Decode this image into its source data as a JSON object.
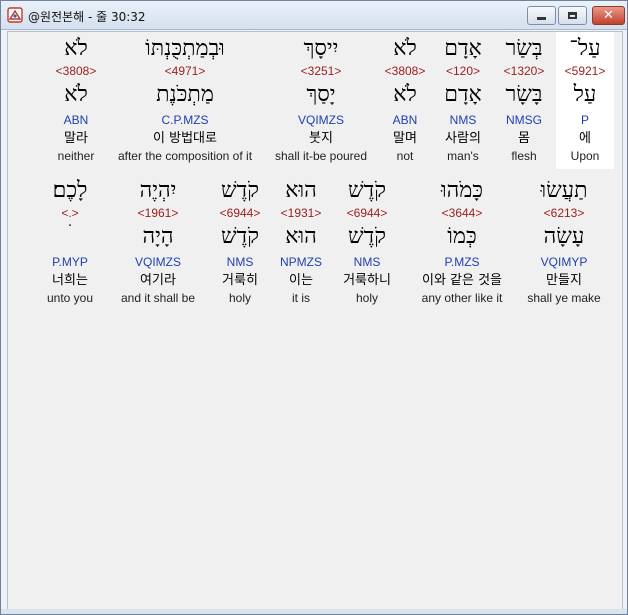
{
  "window": {
    "title": "@원전본해 - 줄 30:32",
    "minimize_label": "",
    "close_label": "✕"
  },
  "rows": [
    [
      {
        "heb": "עַל־",
        "strong": "<5921>",
        "heb2": "עַל",
        "parse": "P",
        "ko": "에",
        "en": "Upon",
        "selected": true
      },
      {
        "heb": "בְּשַׂר",
        "strong": "<1320>",
        "heb2": "בָּשָׂר",
        "parse": "NMSG",
        "ko": "몸",
        "en": "flesh"
      },
      {
        "heb": "אָדָם",
        "strong": "<120>",
        "heb2": "אָדָם",
        "parse": "NMS",
        "ko": "사람의",
        "en": "man's"
      },
      {
        "heb": "לֹא",
        "strong": "<3808>",
        "heb2": "לֹא",
        "parse": "ABN",
        "ko": "말며",
        "en": "not"
      },
      {
        "heb": "יִיסָךְ",
        "strong": "<3251>",
        "heb2": "יָסַךְ",
        "parse": "VQIMZS",
        "ko": "붓지",
        "en": "shall it-be poured"
      },
      {
        "heb": "וּבְמַתְכֻּנְתּוֹ",
        "strong": "<4971>",
        "heb2": "מַתְכֹּנֶת",
        "parse": "C.P.MZS",
        "ko": "이 방법대로",
        "en": "after the composition of it"
      },
      {
        "heb": "לֹא",
        "strong": "<3808>",
        "heb2": "לֹא",
        "parse": "ABN",
        "ko": "말라",
        "en": "neither"
      }
    ],
    [
      {
        "heb": "תַעֲשׂוּ",
        "strong": "<6213>",
        "heb2": "עָשָׂה",
        "parse": "VQIMYP",
        "ko": "만들지",
        "en": "shall ye make"
      },
      {
        "heb": "כָּמֹהוּ",
        "strong": "<3644>",
        "heb2": "כְּמוֹ",
        "parse": "P.MZS",
        "ko": "이와 같은 것을",
        "en": "any other like it"
      },
      {
        "heb": "קֹדֶשׁ",
        "strong": "<6944>",
        "heb2": "קֹדֶשׁ",
        "parse": "NMS",
        "ko": "거룩하니",
        "en": "holy"
      },
      {
        "heb": "הוּא",
        "strong": "<1931>",
        "heb2": "הוּא",
        "parse": "NPMZS",
        "ko": "이는",
        "en": "it is"
      },
      {
        "heb": "קֹדֶשׁ",
        "strong": "<6944>",
        "heb2": "קֹדֶשׁ",
        "parse": "NMS",
        "ko": "거룩히",
        "en": "holy"
      },
      {
        "heb": "יִהְיֶה",
        "strong": "<1961>",
        "heb2": "הָיָה",
        "parse": "VQIMZS",
        "ko": "여기라",
        "en": "and it shall be"
      },
      {
        "heb": "לָכֶם׃",
        "strong": "<.>",
        "heb2": "ׄ",
        "parse": "P.MYP",
        "ko": "너희는",
        "en": "unto you"
      }
    ]
  ]
}
